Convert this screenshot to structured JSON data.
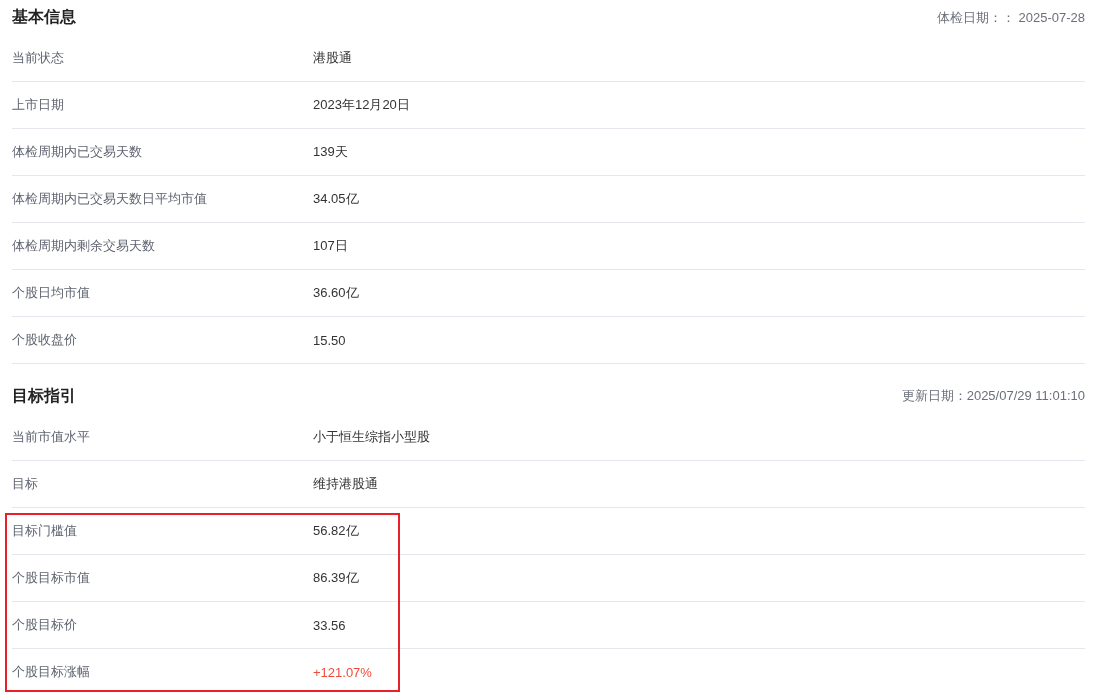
{
  "sections": [
    {
      "title": "基本信息",
      "date": "体检日期：： 2025-07-28",
      "rows": [
        {
          "label": "当前状态",
          "value": "港股通",
          "kind": "plain",
          "highlighted": false
        },
        {
          "label": "上市日期",
          "value": "2023年12月20日",
          "kind": "plain",
          "highlighted": false
        },
        {
          "label": "体检周期内已交易天数",
          "value": "139天",
          "kind": "plain",
          "highlighted": false
        },
        {
          "label": "体检周期内已交易天数日平均市值",
          "value": "34.05亿",
          "kind": "plain",
          "highlighted": false
        },
        {
          "label": "体检周期内剩余交易天数",
          "value": "107日",
          "kind": "plain",
          "highlighted": false
        },
        {
          "label": "个股日均市值",
          "value": "36.60亿",
          "kind": "plain",
          "highlighted": false
        },
        {
          "label": "个股收盘价",
          "value": "15.50",
          "kind": "plain",
          "highlighted": false
        }
      ]
    },
    {
      "title": "目标指引",
      "date": "更新日期：2025/07/29 11:01:10",
      "rows": [
        {
          "label": "当前市值水平",
          "value": "小于恒生综指小型股",
          "kind": "plain",
          "highlighted": false
        },
        {
          "label": "目标",
          "value": "维持港股通",
          "kind": "plain",
          "highlighted": false
        },
        {
          "label": "目标门槛值",
          "value": "56.82亿",
          "kind": "plain",
          "highlighted": true
        },
        {
          "label": "个股目标市值",
          "value": "86.39亿",
          "kind": "plain",
          "highlighted": true
        },
        {
          "label": "个股目标价",
          "value": "33.56",
          "kind": "plain",
          "highlighted": true
        },
        {
          "label": "个股目标涨幅",
          "value": "+121.07%",
          "kind": "rise",
          "highlighted": true
        }
      ]
    }
  ]
}
